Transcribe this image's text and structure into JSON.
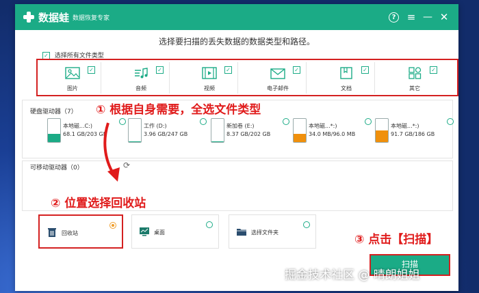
{
  "titlebar": {
    "app_name": "数据蛙",
    "app_subtitle": "数据恢复专家",
    "help_icon": "?"
  },
  "prompt": "选择要扫描的丢失数据的数据类型和路径。",
  "select_all": {
    "label": "选择所有文件类型",
    "checked": true
  },
  "file_types": [
    {
      "label": "图片",
      "icon": "image-icon",
      "checked": true
    },
    {
      "label": "音频",
      "icon": "music-icon",
      "checked": true
    },
    {
      "label": "视频",
      "icon": "video-icon",
      "checked": true
    },
    {
      "label": "电子邮件",
      "icon": "email-icon",
      "checked": true
    },
    {
      "label": "文档",
      "icon": "document-icon",
      "checked": true
    },
    {
      "label": "其它",
      "icon": "other-icon",
      "checked": true
    }
  ],
  "hard_drives": {
    "title": "硬盘驱动器（7）",
    "items": [
      {
        "name": "本地磁...C:)",
        "size": "68.1 GB/203 GB",
        "fill": 0.34,
        "color": "#1bab86"
      },
      {
        "name": "工作 (D:)",
        "size": "3.96 GB/247 GB",
        "fill": 0.02,
        "color": "#1bab86"
      },
      {
        "name": "新加卷 (E:)",
        "size": "8.37 GB/202 GB",
        "fill": 0.04,
        "color": "#1bab86"
      },
      {
        "name": "本地磁...*:)",
        "size": "34.0 MB/96.0 MB",
        "fill": 0.35,
        "color": "#f0900c"
      },
      {
        "name": "本地磁...*:)",
        "size": "91.7 GB/186 GB",
        "fill": 0.49,
        "color": "#f0900c"
      }
    ]
  },
  "removable": {
    "title": "可移动驱动器（0）",
    "refresh_icon": "refresh-icon"
  },
  "locations": [
    {
      "label": "回收站",
      "icon": "recycle-bin-icon",
      "selected": true
    },
    {
      "label": "桌面",
      "icon": "desktop-icon",
      "selected": false
    },
    {
      "label": "选择文件夹",
      "icon": "folder-icon",
      "selected": false
    }
  ],
  "annotations": {
    "a1": "① 根据自身需要，全选文件类型",
    "a2": "② 位置选择回收站",
    "a3": "③ 点击【扫描】"
  },
  "scan_button": "扫描",
  "watermark": "掘金技术社区 @ 晴朗姐姐",
  "colors": {
    "accent": "#1bab86",
    "annotation": "#d42020"
  }
}
